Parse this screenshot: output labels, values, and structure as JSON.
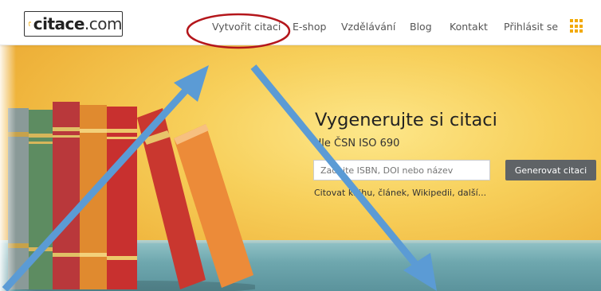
{
  "header": {
    "logo": {
      "text_bold": "citace",
      "text_suffix": ".com"
    },
    "nav": [
      {
        "label": "Vytvořit citaci"
      },
      {
        "label": "E-shop"
      },
      {
        "label": "Vzdělávání"
      },
      {
        "label": "Blog"
      },
      {
        "label": "Kontakt"
      },
      {
        "label": "Přihlásit se"
      }
    ],
    "apps_icon": "grid-icon"
  },
  "hero": {
    "title": "Vygenerujte si citaci",
    "subtitle": "dle ČSN ISO 690",
    "search": {
      "placeholder": "Zadejte ISBN, DOI nebo název",
      "value": ""
    },
    "button_label": "Generovat citaci",
    "hint": "Citovat knihu, článek, Wikipedii, další..."
  },
  "annotation": {
    "highlight_target": "Vytvořit citaci",
    "ellipse_color": "#b4161b",
    "arrow_color": "#5b9bd5"
  }
}
